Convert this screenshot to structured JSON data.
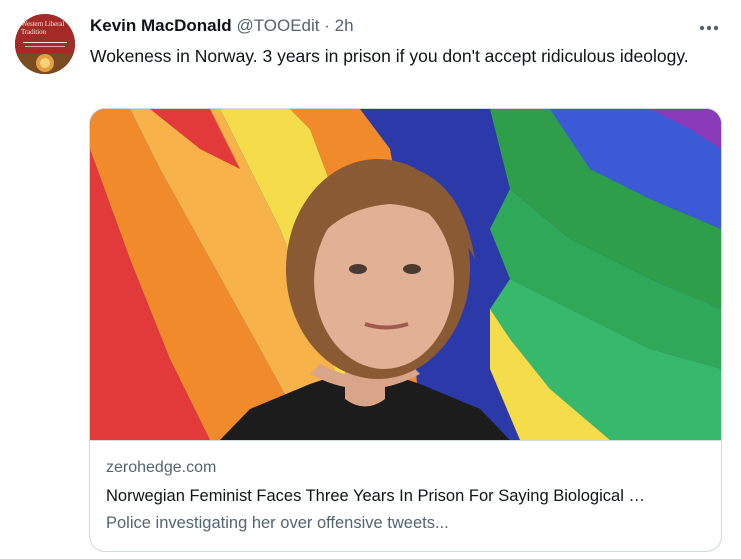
{
  "tweet": {
    "author_name": "Kevin MacDonald",
    "author_handle": "@TOOEdit",
    "separator": "·",
    "time": "2h",
    "text": "Wokeness in Norway. 3 years in prison if you don't accept ridiculous ideology.",
    "more_icon": "more-horizontal-icon"
  },
  "avatar": {
    "text_line1": "Western Liberal",
    "text_line2": "Tradition",
    "colors": {
      "background": "#a32a26",
      "text": "#f3e6d4"
    }
  },
  "card": {
    "domain": "zerohedge.com",
    "title": "Norwegian Feminist Faces Three Years In Prison For Saying Biological …",
    "description": "Police investigating her over offensive tweets..."
  },
  "colors": {
    "text_primary": "#0f1419",
    "text_secondary": "#536471",
    "border": "#cfd9de"
  }
}
